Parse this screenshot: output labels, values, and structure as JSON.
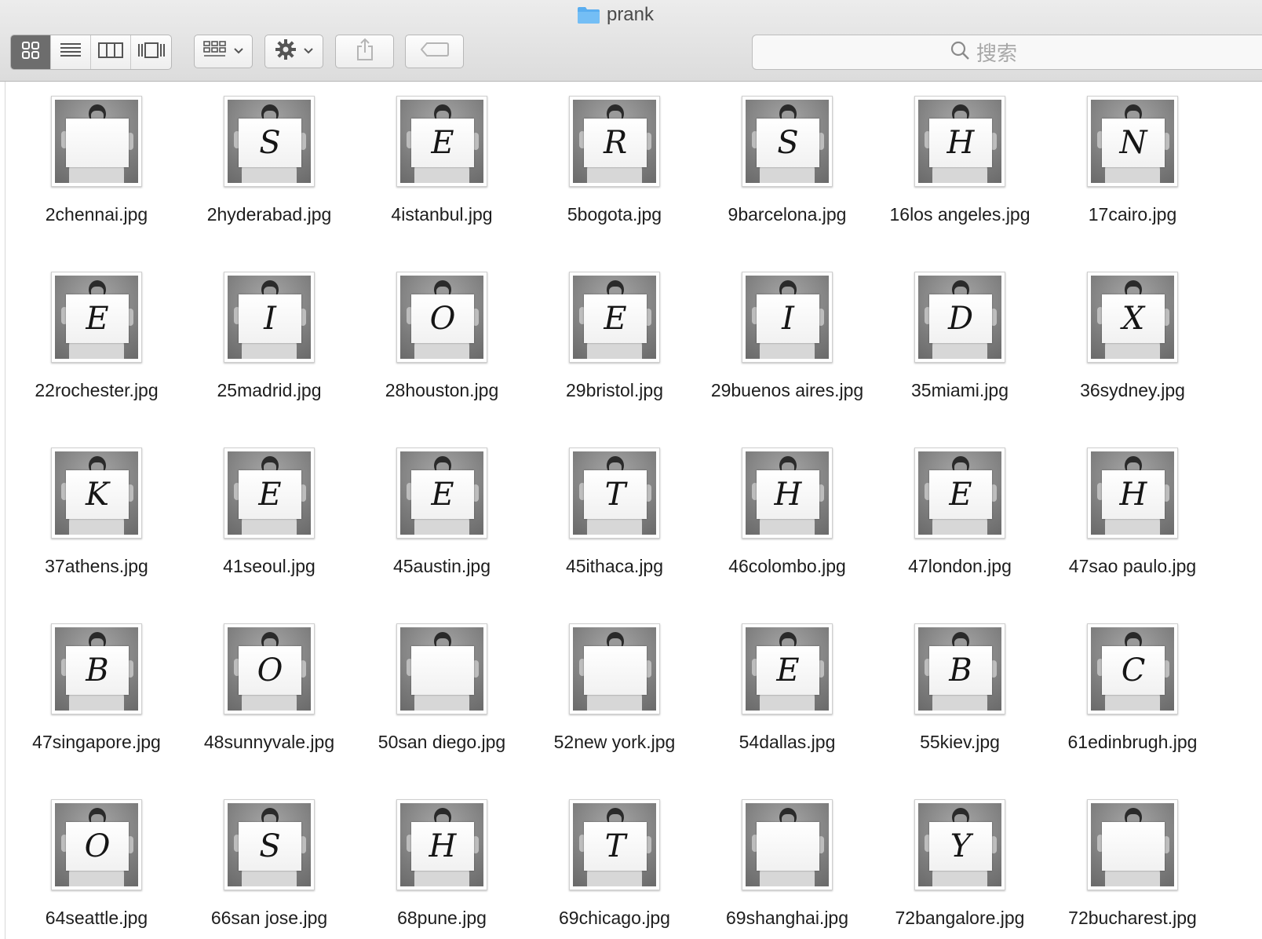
{
  "window": {
    "title": "prank",
    "folder_icon": "folder-icon",
    "accent_color": "#5aaef0"
  },
  "toolbar": {
    "view_buttons": [
      {
        "icon": "icon-view-icon",
        "active": true
      },
      {
        "icon": "list-view-icon",
        "active": false
      },
      {
        "icon": "column-view-icon",
        "active": false
      },
      {
        "icon": "coverflow-view-icon",
        "active": false
      }
    ],
    "arrange_icon": "arrange-grid-icon",
    "action_icon": "gear-icon",
    "share_icon": "share-icon",
    "tag_icon": "tag-icon",
    "search": {
      "placeholder": "搜索",
      "icon": "search-icon"
    }
  },
  "files": [
    {
      "name": "2chennai.jpg",
      "letter": ""
    },
    {
      "name": "2hyderabad.jpg",
      "letter": "S"
    },
    {
      "name": "4istanbul.jpg",
      "letter": "E"
    },
    {
      "name": "5bogota.jpg",
      "letter": "R"
    },
    {
      "name": "9barcelona.jpg",
      "letter": "S"
    },
    {
      "name": "16los angeles.jpg",
      "letter": "H"
    },
    {
      "name": "17cairo.jpg",
      "letter": "N"
    },
    {
      "name": "22rochester.jpg",
      "letter": "E"
    },
    {
      "name": "25madrid.jpg",
      "letter": "I"
    },
    {
      "name": "28houston.jpg",
      "letter": "O"
    },
    {
      "name": "29bristol.jpg",
      "letter": "E"
    },
    {
      "name": "29buenos aires.jpg",
      "letter": "I"
    },
    {
      "name": "35miami.jpg",
      "letter": "D"
    },
    {
      "name": "36sydney.jpg",
      "letter": "X"
    },
    {
      "name": "37athens.jpg",
      "letter": "K"
    },
    {
      "name": "41seoul.jpg",
      "letter": "E"
    },
    {
      "name": "45austin.jpg",
      "letter": "E"
    },
    {
      "name": "45ithaca.jpg",
      "letter": "T"
    },
    {
      "name": "46colombo.jpg",
      "letter": "H"
    },
    {
      "name": "47london.jpg",
      "letter": "E"
    },
    {
      "name": "47sao paulo.jpg",
      "letter": "H"
    },
    {
      "name": "47singapore.jpg",
      "letter": "B"
    },
    {
      "name": "48sunnyvale.jpg",
      "letter": "O"
    },
    {
      "name": "50san diego.jpg",
      "letter": ""
    },
    {
      "name": "52new york.jpg",
      "letter": ""
    },
    {
      "name": "54dallas.jpg",
      "letter": "E"
    },
    {
      "name": "55kiev.jpg",
      "letter": "B"
    },
    {
      "name": "61edinbrugh.jpg",
      "letter": "C"
    },
    {
      "name": "64seattle.jpg",
      "letter": "O"
    },
    {
      "name": "66san jose.jpg",
      "letter": "S"
    },
    {
      "name": "68pune.jpg",
      "letter": "H"
    },
    {
      "name": "69chicago.jpg",
      "letter": "T"
    },
    {
      "name": "69shanghai.jpg",
      "letter": ""
    },
    {
      "name": "72bangalore.jpg",
      "letter": "Y"
    },
    {
      "name": "72bucharest.jpg",
      "letter": ""
    }
  ]
}
